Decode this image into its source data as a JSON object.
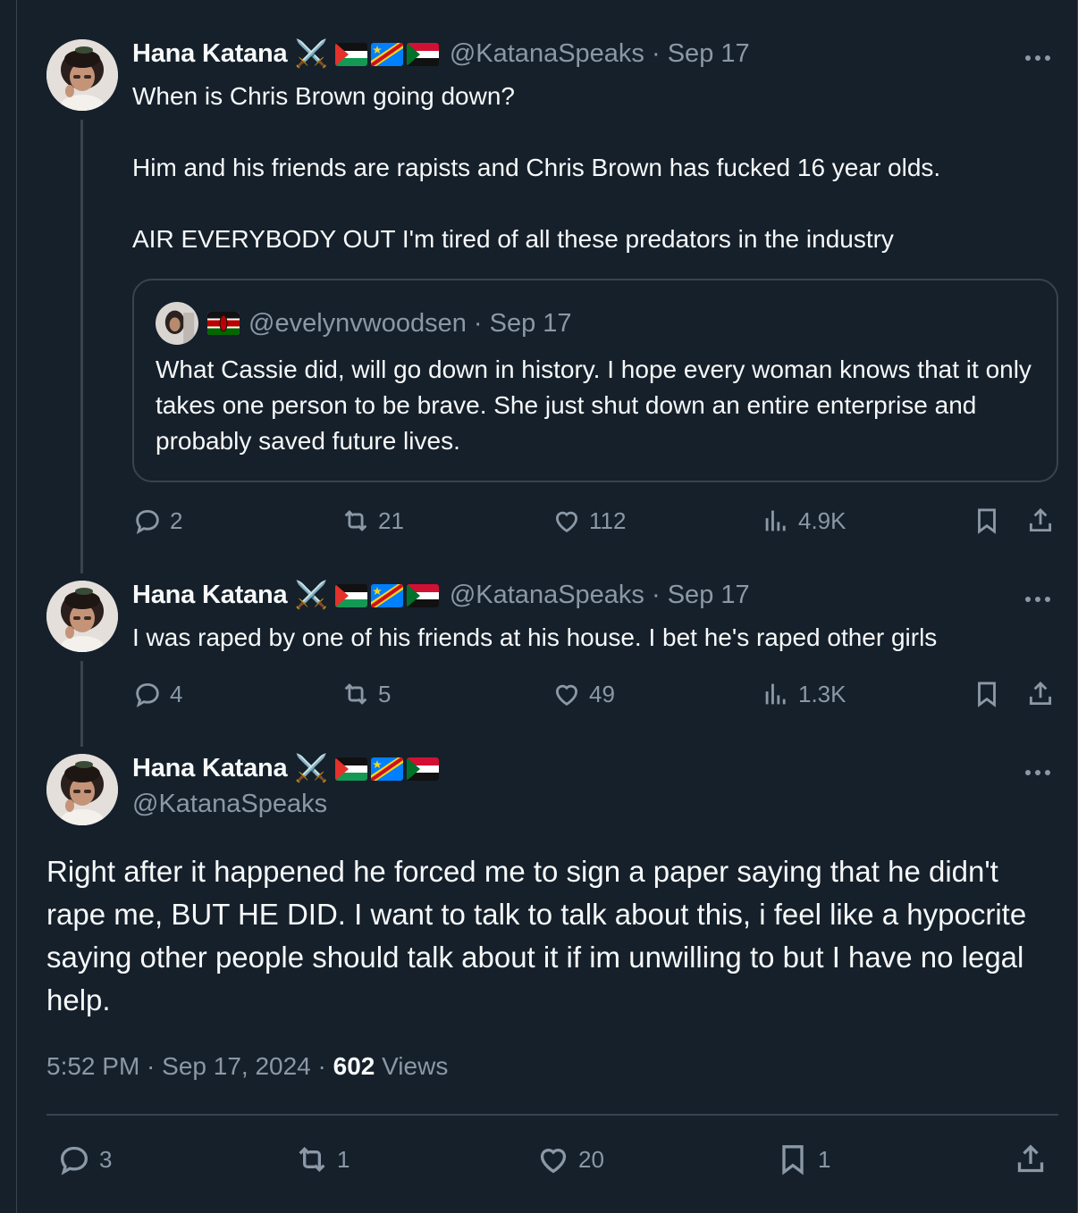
{
  "tweets": [
    {
      "name": "Hana Katana",
      "handle": "@KatanaSpeaks",
      "date": "Sep 17",
      "lines": [
        "When is Chris Brown going down?",
        "Him and his friends are rapists and Chris Brown has fucked 16 year olds.",
        "AIR EVERYBODY OUT I'm tired of all these predators in the industry"
      ],
      "quote": {
        "handle": "@evelynvwoodsen",
        "date": "Sep 17",
        "text": "What Cassie did, will go down in history. I hope every woman knows that it only takes one person to be brave. She just shut down an entire enterprise and probably saved future lives."
      },
      "replies": "2",
      "reposts": "21",
      "likes": "112",
      "views": "4.9K"
    },
    {
      "name": "Hana Katana",
      "handle": "@KatanaSpeaks",
      "date": "Sep 17",
      "text": "I was raped by one of his friends at his house. I bet he's raped other girls",
      "replies": "4",
      "reposts": "5",
      "likes": "49",
      "views": "1.3K"
    }
  ],
  "main": {
    "name": "Hana Katana",
    "handle": "@KatanaSpeaks",
    "text": "Right after it happened he forced me to sign a paper saying that he didn't rape me, BUT HE DID. I want to talk to talk about this, i feel like a hypocrite saying other people should talk about it if im unwilling to but I have no legal help.",
    "time": "5:52 PM · Sep 17, 2024 · ",
    "views_count": "602",
    "views_label": " Views",
    "replies": "3",
    "reposts": "1",
    "likes": "20",
    "bookmarks": "1"
  },
  "separator": " · ",
  "icons": [
    "crossed-swords-icon",
    "palestine-flag-icon",
    "dr-congo-flag-icon",
    "sudan-flag-icon",
    "kenya-flag-icon",
    "reply-icon",
    "repost-icon",
    "like-icon",
    "views-icon",
    "bookmark-icon",
    "share-icon",
    "more-icon"
  ],
  "colors": {
    "background": "#15202b",
    "text": "#f7f9f9",
    "muted": "#8b98a5",
    "border": "#38444d"
  }
}
